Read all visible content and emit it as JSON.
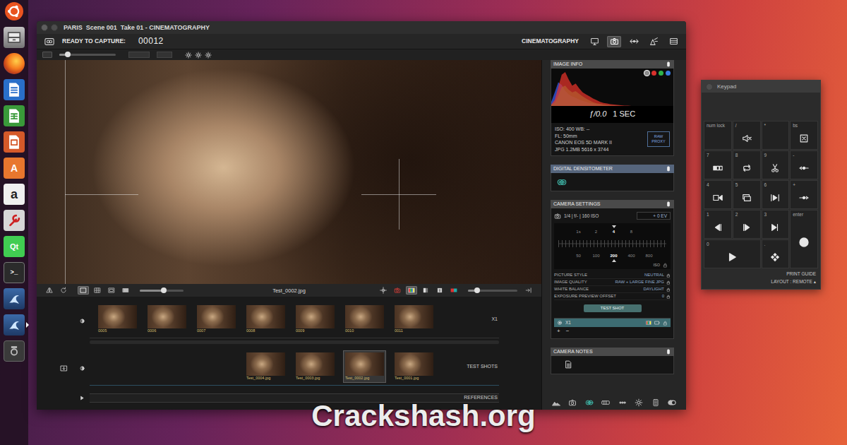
{
  "desktop": {
    "watermark": "Crackshash.org"
  },
  "dock": [
    {
      "kind": "ubuntu",
      "running": false
    },
    {
      "kind": "files",
      "running": false
    },
    {
      "kind": "firefox",
      "running": false
    },
    {
      "kind": "writer",
      "running": false
    },
    {
      "kind": "calc",
      "running": false
    },
    {
      "kind": "impress",
      "running": false
    },
    {
      "kind": "software",
      "text": "A",
      "running": false
    },
    {
      "kind": "amazon",
      "text": "a",
      "running": false
    },
    {
      "kind": "settings",
      "running": false
    },
    {
      "kind": "qt",
      "text": "Qt",
      "running": false
    },
    {
      "kind": "terminal",
      "text": ">_",
      "running": false
    },
    {
      "kind": "dragon",
      "running": false
    },
    {
      "kind": "dragon",
      "running": true
    },
    {
      "kind": "device",
      "running": false
    }
  ],
  "window": {
    "title": "PARIS  Scene 001  Take 01 - CINEMATOGRAPHY"
  },
  "toolbar": {
    "status_label": "READY TO CAPTURE:",
    "frame": "00012",
    "mode": "CINEMATOGRAPHY",
    "mode_buttons": [
      {
        "kind": "monitor",
        "selected": false
      },
      {
        "kind": "camera",
        "selected": true
      },
      {
        "kind": "move",
        "selected": false
      },
      {
        "kind": "light",
        "selected": false
      },
      {
        "kind": "panels",
        "selected": false
      }
    ]
  },
  "subtoolbar": {
    "slider_level": 0.15
  },
  "viewer": {
    "filename": "Test_0002.jpg",
    "view_modes": [
      {
        "kind": "view1",
        "selected": true
      },
      {
        "kind": "view2",
        "selected": false
      },
      {
        "kind": "view3",
        "selected": false
      },
      {
        "kind": "view4",
        "selected": false
      }
    ],
    "zoom_level": 0.55,
    "overlays": [
      {
        "kind": "crosshair",
        "selected": false
      },
      {
        "kind": "cam-red",
        "selected": false
      },
      {
        "kind": "rgb",
        "selected": true
      },
      {
        "kind": "grey",
        "selected": false
      },
      {
        "kind": "info",
        "selected": false
      },
      {
        "kind": "pair",
        "selected": false
      }
    ],
    "opacity_level": 0.18
  },
  "timeline": {
    "rows": [
      {
        "kind": "camera",
        "label": "X1",
        "frames": [
          {
            "label": "0005",
            "selected": false
          },
          {
            "label": "0006",
            "selected": false
          },
          {
            "label": "0007",
            "selected": false
          },
          {
            "label": "0008",
            "selected": false
          },
          {
            "label": "0009",
            "selected": false
          },
          {
            "label": "0010",
            "selected": false
          },
          {
            "label": "0011",
            "selected": false
          }
        ]
      },
      {
        "kind": "tests",
        "label": "TEST SHOTS",
        "frames": [
          {
            "label": "Test_0004.jpg",
            "selected": false
          },
          {
            "label": "Test_0003.jpg",
            "selected": false
          },
          {
            "label": "Test_0002.jpg",
            "selected": true
          },
          {
            "label": "Test_0001.jpg",
            "selected": false
          }
        ]
      },
      {
        "kind": "references",
        "label": "REFERENCES",
        "frames": []
      }
    ]
  },
  "image_info": {
    "title": "IMAGE INFO",
    "channels": [
      {
        "color": "#8c8c8c",
        "selected": true
      },
      {
        "color": "#d8312c",
        "selected": false
      },
      {
        "color": "#2fb34a",
        "selected": false
      },
      {
        "color": "#3a7be0",
        "selected": false
      }
    ],
    "histogram": {
      "series": [
        {
          "color": "#3a5cf0",
          "values": [
            12,
            40,
            70,
            62,
            45,
            34,
            28,
            24,
            19,
            15,
            12,
            9,
            7,
            5,
            4,
            3,
            2,
            1,
            1,
            0,
            0,
            0,
            0,
            0,
            0,
            0,
            0,
            0,
            0,
            0,
            0,
            0,
            0,
            0,
            0,
            0
          ]
        },
        {
          "color": "#35c23a",
          "values": [
            3,
            10,
            30,
            55,
            60,
            48,
            40,
            44,
            36,
            28,
            22,
            16,
            11,
            8,
            6,
            4,
            3,
            2,
            1,
            1,
            0,
            0,
            0,
            0,
            0,
            0,
            0,
            0,
            0,
            0,
            0,
            0,
            0,
            0,
            0,
            0
          ]
        },
        {
          "color": "#e8332a",
          "values": [
            4,
            18,
            55,
            92,
            100,
            78,
            60,
            66,
            52,
            40,
            34,
            28,
            22,
            17,
            12,
            9,
            7,
            5,
            4,
            3,
            2,
            1,
            1,
            0,
            0,
            0,
            0,
            0,
            0,
            0,
            0,
            0,
            0,
            0,
            0,
            0
          ]
        }
      ]
    },
    "aperture": "ƒ/0.0",
    "shutter": "1 SEC",
    "details": [
      "ISO: 400  WB: --",
      "FL: 50mm",
      "CANON EOS 5D MARK II",
      "JPG 1.2MB 5616 x 3744"
    ],
    "proxy_button": "RAW PROXY"
  },
  "densitometer": {
    "title": "DIGITAL DENSITOMETER"
  },
  "camera_settings": {
    "title": "CAMERA SETTINGS",
    "exposure": "1/4 | f/- | 160 ISO",
    "ev": "+ 0 EV",
    "shutter_ticks": [
      {
        "label": "1s",
        "selected": false
      },
      {
        "label": "2",
        "selected": false
      },
      {
        "label": "4",
        "selected": true
      },
      {
        "label": "8",
        "selected": false
      }
    ],
    "iso_ticks": [
      {
        "label": "50",
        "selected": false
      },
      {
        "label": "100",
        "selected": false
      },
      {
        "label": "200",
        "selected": true
      },
      {
        "label": "400",
        "selected": false
      },
      {
        "label": "800",
        "selected": false
      }
    ],
    "iso_label": "ISO",
    "settings": [
      {
        "label": "PICTURE STYLE",
        "value": "NEUTRAL"
      },
      {
        "label": "IMAGE QUALITY",
        "value": "RAW + LARGE FINE JPG"
      },
      {
        "label": "WHITE BALANCE",
        "value": "DAYLIGHT"
      },
      {
        "label": "EXPOSURE PREVIEW OFFSET",
        "value": "0"
      }
    ],
    "test_button": "TEST SHOT",
    "camera": {
      "label": "X1",
      "selected": true
    },
    "add": "+",
    "remove": "−"
  },
  "camera_notes": {
    "title": "CAMERA NOTES"
  },
  "bottom_tools": [
    {
      "kind": "scene"
    },
    {
      "kind": "camera"
    },
    {
      "kind": "dens"
    },
    {
      "kind": "bars"
    },
    {
      "kind": "dots"
    },
    {
      "kind": "gear"
    },
    {
      "kind": "notes"
    },
    {
      "kind": "toggle"
    }
  ],
  "keypad": {
    "title": "Keypad",
    "keys": [
      {
        "label": "num lock",
        "kind": "none"
      },
      {
        "label": "/",
        "kind": "mute"
      },
      {
        "label": "*",
        "kind": "none"
      },
      {
        "label": "bs",
        "kind": "delete"
      },
      {
        "label": "7",
        "kind": "frames"
      },
      {
        "label": "8",
        "kind": "loop"
      },
      {
        "label": "9",
        "kind": "cut"
      },
      {
        "label": "-",
        "kind": "back-step"
      },
      {
        "label": "4",
        "kind": "live"
      },
      {
        "label": "5",
        "kind": "swap"
      },
      {
        "label": "6",
        "kind": "to-live"
      },
      {
        "label": "+",
        "kind": "fwd-step"
      },
      {
        "label": "1",
        "kind": "step-back"
      },
      {
        "label": "2",
        "kind": "step-fwd"
      },
      {
        "label": "3",
        "kind": "to-end"
      },
      {
        "label": "enter",
        "kind": "shoot"
      },
      {
        "label": "0",
        "kind": "play"
      },
      {
        "label": ".",
        "kind": "nudge"
      }
    ],
    "footer": [
      "PRINT GUIDE",
      "LAYOUT : REMOTE ▴"
    ]
  }
}
